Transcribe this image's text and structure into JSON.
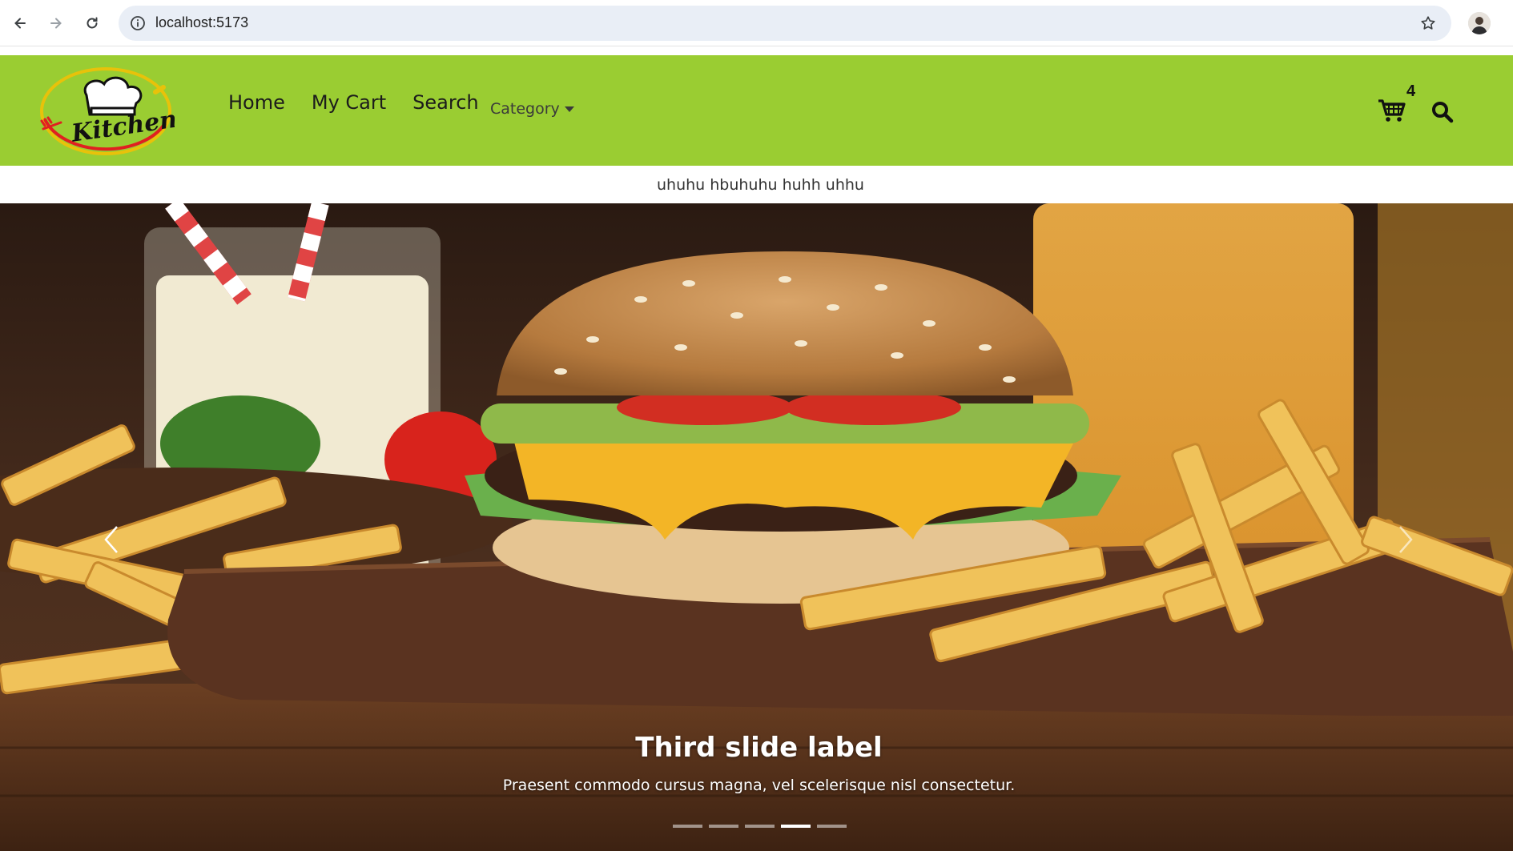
{
  "browser": {
    "url": "localhost:5173",
    "back_icon": "arrow-left-icon",
    "forward_icon": "arrow-right-icon",
    "reload_icon": "reload-icon",
    "bookmark_icon": "star-outline-icon"
  },
  "navbar": {
    "background": "#9acd32",
    "logo_text": "Kitchen",
    "links": [
      "Home",
      "My Cart",
      "Search"
    ],
    "category_label": "Category",
    "cart_count": "4"
  },
  "announcement": {
    "text": "uhuhu hbuhuhu huhh uhhu"
  },
  "carousel": {
    "caption_title": "Third slide label",
    "caption_text": "Praesent commodo cursus magna, vel scelerisque nisl consectetur.",
    "slide_count": 5,
    "active_index": 3
  }
}
